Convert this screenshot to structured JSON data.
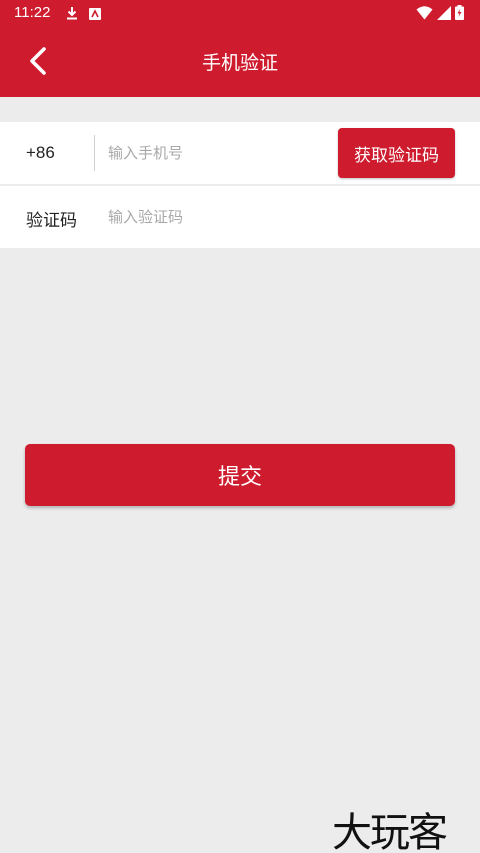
{
  "status_bar": {
    "time": "11:22",
    "icons": [
      "download-icon",
      "app-notification-icon",
      "wifi-icon",
      "signal-icon",
      "battery-icon"
    ]
  },
  "nav": {
    "back_icon": "chevron-left-icon",
    "title": "手机验证"
  },
  "phone_row": {
    "prefix": "+86",
    "placeholder": "输入手机号",
    "value": "",
    "get_code_label": "获取验证码"
  },
  "code_row": {
    "label": "验证码",
    "placeholder": "输入验证码",
    "value": ""
  },
  "submit_label": "提交",
  "watermark": "大玩客",
  "colors": {
    "primary": "#cf1b2e",
    "background": "#ececec",
    "placeholder": "#a8a8a8"
  }
}
